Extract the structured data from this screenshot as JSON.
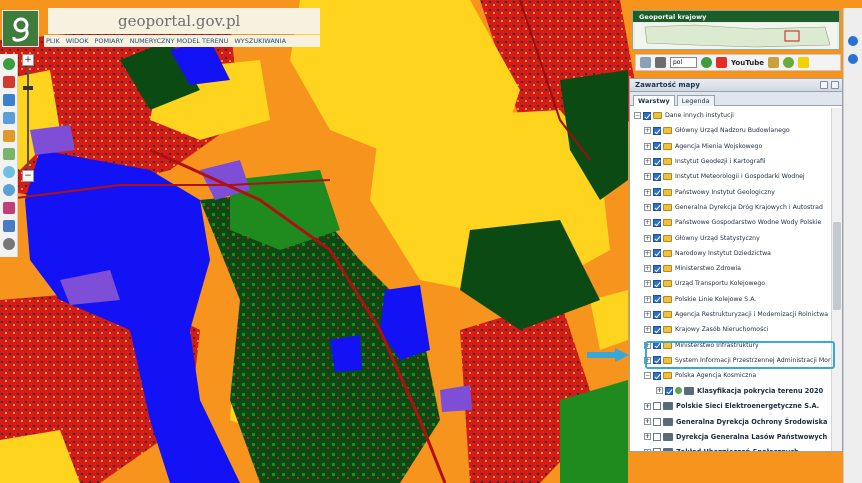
{
  "app": {
    "logo_text": "geoportal.gov.pl",
    "menu": [
      "PLIK",
      "WIDOK",
      "POMIARY",
      "NUMERYCZNY MODEL TERENU",
      "WYSZUKIWANIA"
    ]
  },
  "overview": {
    "title": "Geoportal krajowy"
  },
  "toolbar": {
    "language": "pol",
    "youtube_label": "YouTube"
  },
  "panel": {
    "title": "Zawartość mapy",
    "tabs": [
      "Warstwy",
      "Legenda"
    ],
    "tree": [
      {
        "label": "Dane innych instytucji",
        "type": "group",
        "checked": true
      },
      {
        "label": "Główny Urząd Nadzoru Budowlanego",
        "type": "folder",
        "checked": true
      },
      {
        "label": "Agencja Mienia Wojskowego",
        "type": "folder",
        "checked": true
      },
      {
        "label": "Instytut Geodezji i Kartografii",
        "type": "folder",
        "checked": true
      },
      {
        "label": "Instytut Meteorologii i Gospodarki Wodnej",
        "type": "folder",
        "checked": true
      },
      {
        "label": "Państwowy Instytut Geologiczny",
        "type": "folder",
        "checked": true
      },
      {
        "label": "Generalna Dyrekcja Dróg Krajowych i Autostrad",
        "type": "folder",
        "checked": true
      },
      {
        "label": "Państwowe Gospodarstwo Wodne Wody Polskie",
        "type": "folder",
        "checked": true
      },
      {
        "label": "Główny Urząd Statystyczny",
        "type": "folder",
        "checked": true
      },
      {
        "label": "Narodowy Instytut Dziedzictwa",
        "type": "folder",
        "checked": true
      },
      {
        "label": "Ministerstwo Zdrowia",
        "type": "folder",
        "checked": true
      },
      {
        "label": "Urząd Transportu Kolejowego",
        "type": "folder",
        "checked": true
      },
      {
        "label": "Polskie Linie Kolejowe S.A.",
        "type": "folder",
        "checked": true
      },
      {
        "label": "Agencja Restrukturyzacji i Modernizacji Rolnictwa",
        "type": "folder",
        "checked": true
      },
      {
        "label": "Krajowy Zasób Nieruchomości",
        "type": "folder",
        "checked": true
      },
      {
        "label": "Ministerstwo Infrastruktury",
        "type": "folder",
        "checked": true
      },
      {
        "label": "System Informacji Przestrzennej Administracji Morskiej",
        "type": "folder",
        "checked": true
      },
      {
        "label": "Polska Agencja Kosmiczna",
        "type": "folder",
        "checked": true
      },
      {
        "label": "Klasyfikacja pokrycia terenu 2020",
        "type": "layer",
        "checked": true
      },
      {
        "label": "Polskie Sieci Elektroenergetyczne S.A.",
        "type": "layer",
        "checked": false
      },
      {
        "label": "Generalna Dyrekcja Ochrony Środowiska",
        "type": "layer",
        "checked": false
      },
      {
        "label": "Dyrekcja Generalna Lasów Państwowych",
        "type": "layer",
        "checked": false
      },
      {
        "label": "Zakład Ubezpieczeń Społecznych",
        "type": "layer",
        "checked": false
      }
    ]
  },
  "colors": {
    "agri_yellow": "#fed41e",
    "arable_orange": "#f7941d",
    "urban_red": "#d7191c",
    "forest_dark": "#0b4a12",
    "forest_green": "#1f8a1e",
    "water_blue": "#1212f5",
    "wetland_purple": "#7e4fd6"
  }
}
